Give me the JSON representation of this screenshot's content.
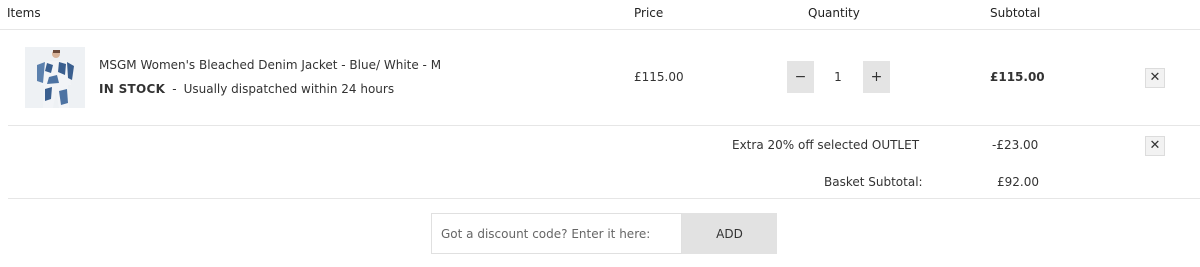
{
  "header": {
    "items": "Items",
    "price": "Price",
    "quantity": "Quantity",
    "subtotal": "Subtotal"
  },
  "item": {
    "name": "MSGM Women's Bleached Denim Jacket - Blue/ White - M",
    "stock_status": "IN STOCK",
    "separator": "-",
    "dispatch": "Usually dispatched within 24 hours",
    "price": "£115.00",
    "quantity": "1",
    "decrement_label": "−",
    "increment_label": "+",
    "subtotal": "£115.00",
    "remove_label": "✕",
    "thumb_colors": {
      "denim": "#3a5f8f",
      "white": "#f2f4f7",
      "skin": "#d8b49a"
    }
  },
  "promo": {
    "label": "Extra 20% off selected OUTLET",
    "amount": "-£23.00",
    "remove_label": "✕"
  },
  "basket": {
    "label": "Basket Subtotal:",
    "value": "£92.00"
  },
  "discount": {
    "placeholder": "Got a discount code? Enter it here:",
    "add_label": "ADD"
  }
}
